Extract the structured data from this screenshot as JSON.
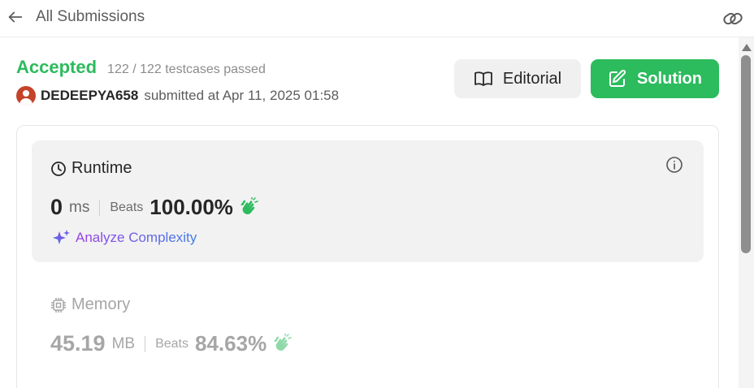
{
  "header": {
    "back_label": "All Submissions",
    "back_icon": "arrow-left-icon",
    "link_icon": "link-icon"
  },
  "submission": {
    "status": "Accepted",
    "testcases": "122 / 122 testcases passed",
    "username": "DEDEEPYA658",
    "submitted_text": "submitted at Apr 11, 2025 01:58"
  },
  "buttons": {
    "editorial_label": "Editorial",
    "solution_label": "Solution"
  },
  "runtime": {
    "title": "Runtime",
    "value": "0",
    "unit": "ms",
    "beats_label": "Beats",
    "beats_value": "100.00%",
    "analyze_label": "Analyze Complexity"
  },
  "memory": {
    "title": "Memory",
    "value": "45.19",
    "unit": "MB",
    "beats_label": "Beats",
    "beats_value": "84.63%"
  },
  "colors": {
    "accent_green": "#2cbb5d",
    "muted_text": "#a6a6a6",
    "analyze_gradient_start": "#9b3fe6",
    "analyze_gradient_end": "#3f7de6"
  }
}
